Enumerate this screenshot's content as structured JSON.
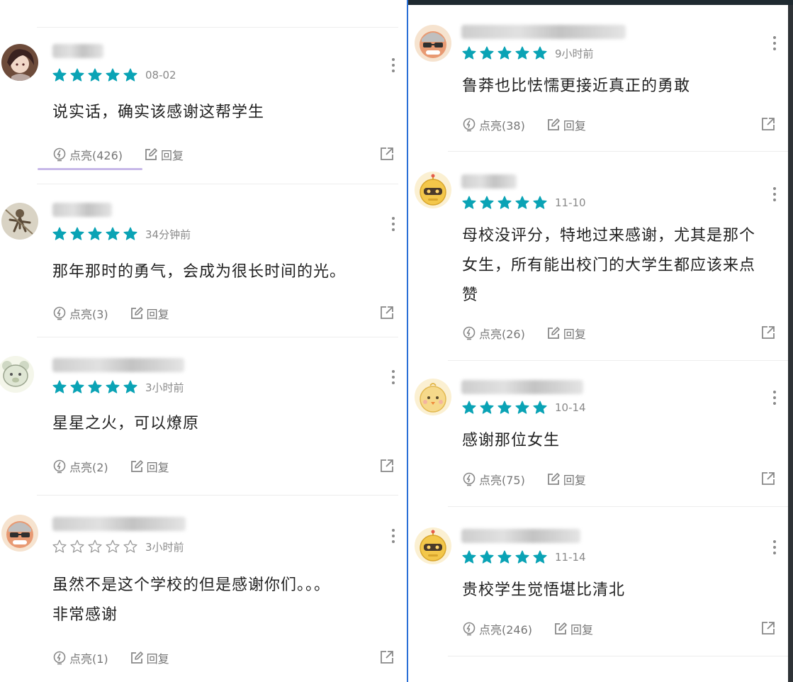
{
  "colors": {
    "star": "#0aa3b5",
    "divider": "#2a6fd6"
  },
  "left_comments": [
    {
      "avatar": "anime-avatar",
      "rating": 5,
      "date": "08-02",
      "text": [
        "说实话，确实该感谢这帮学生"
      ],
      "like_label": "点亮(426)",
      "reply_label": "回复"
    },
    {
      "avatar": "warrior-avatar",
      "rating": 5,
      "date": "34分钟前",
      "text": [
        "那年那时的勇气，会成为很长时间的光。"
      ],
      "like_label": "点亮(3)",
      "reply_label": "回复"
    },
    {
      "avatar": "bear-avatar",
      "rating": 5,
      "date": "3小时前",
      "text": [
        "星星之火，可以燎原"
      ],
      "like_label": "点亮(2)",
      "reply_label": "回复"
    },
    {
      "avatar": "sunglasses-avatar",
      "rating": 0,
      "date": "3小时前",
      "text": [
        "虽然不是这个学校的但是感谢你们。。。",
        "非常感谢"
      ],
      "like_label": "点亮(1)",
      "reply_label": "回复"
    }
  ],
  "right_comments": [
    {
      "avatar": "sunglasses-avatar",
      "rating": 5,
      "date": "9小时前",
      "text": [
        "鲁莽也比怯懦更接近真正的勇敢"
      ],
      "like_label": "点亮(38)",
      "reply_label": "回复"
    },
    {
      "avatar": "robot-avatar",
      "rating": 5,
      "date": "11-10",
      "text": [
        "母校没评分，特地过来感谢，尤其是那个",
        "女生，所有能出校门的大学生都应该来点",
        "赞"
      ],
      "like_label": "点亮(26)",
      "reply_label": "回复"
    },
    {
      "avatar": "chick-avatar",
      "rating": 5,
      "date": "10-14",
      "text": [
        "感谢那位女生"
      ],
      "like_label": "点亮(75)",
      "reply_label": "回复"
    },
    {
      "avatar": "robot-avatar",
      "rating": 5,
      "date": "11-14",
      "text": [
        "贵校学生觉悟堪比清北"
      ],
      "like_label": "点亮(246)",
      "reply_label": "回复"
    }
  ]
}
